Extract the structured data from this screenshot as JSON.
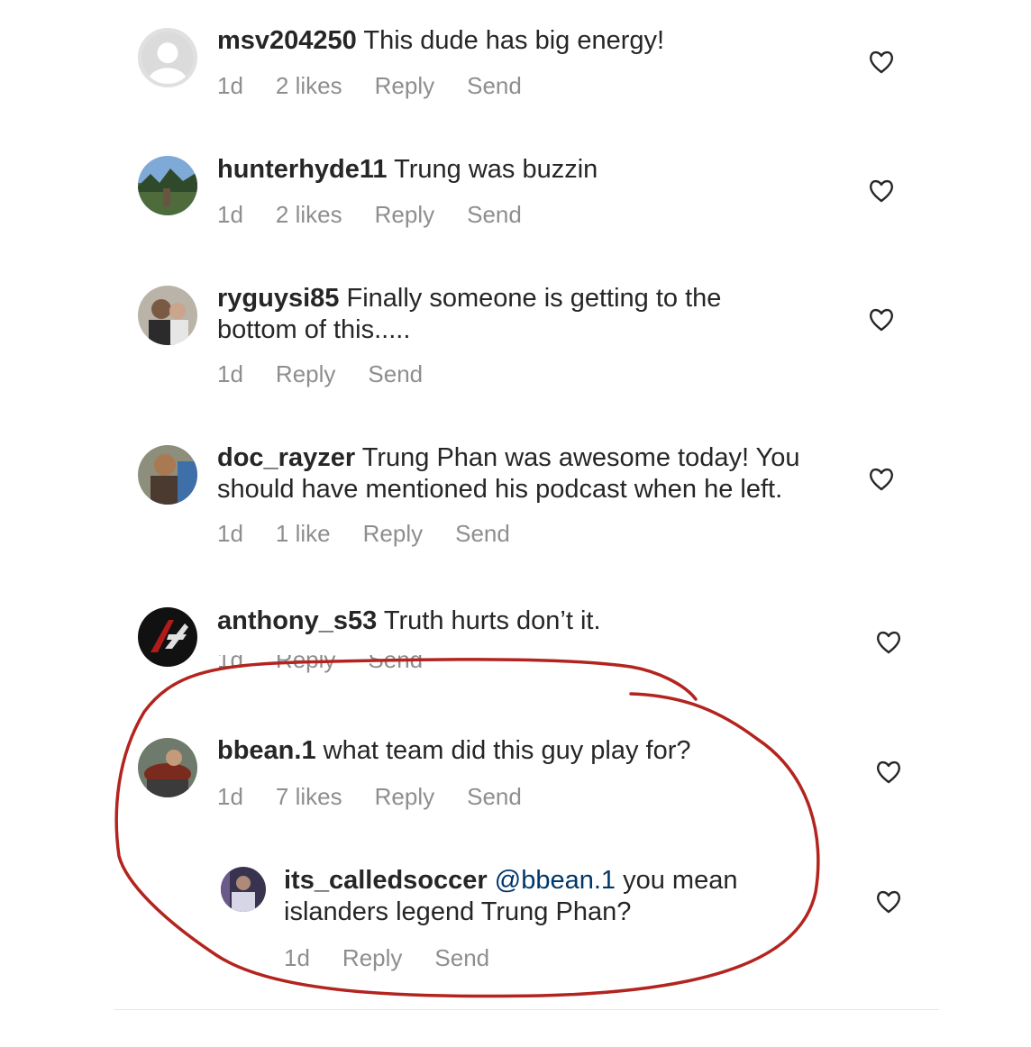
{
  "comments": [
    {
      "username": "msv204250",
      "text": "This dude has big energy!",
      "time": "1d",
      "likes": "2 likes",
      "reply": "Reply",
      "send": "Send"
    },
    {
      "username": "hunterhyde11",
      "text": "Trung was buzzin",
      "time": "1d",
      "likes": "2 likes",
      "reply": "Reply",
      "send": "Send"
    },
    {
      "username": "ryguysi85",
      "text_line1": "Finally someone is getting to the",
      "text_line2": "bottom of this.....",
      "time": "1d",
      "reply": "Reply",
      "send": "Send"
    },
    {
      "username": "doc_rayzer",
      "text_line1": "Trung Phan was awesome today! You",
      "text_line2": "should have mentioned his podcast when he left.",
      "time": "1d",
      "likes": "1 like",
      "reply": "Reply",
      "send": "Send"
    },
    {
      "username": "anthony_s53",
      "text": "Truth hurts don’t it.",
      "time": "1d",
      "reply": "Reply",
      "send": "Send"
    },
    {
      "username": "bbean.1",
      "text": "what team did this guy play for?",
      "time": "1d",
      "likes": "7 likes",
      "reply": "Reply",
      "send": "Send"
    },
    {
      "username": "its_calledsoccer",
      "mention": "@bbean.1",
      "text_line1": "you mean",
      "text_line2": "islanders legend Trung Phan?",
      "time": "1d",
      "reply": "Reply",
      "send": "Send"
    }
  ],
  "icons": {
    "like": "heart-outline-icon",
    "avatar_placeholder": "default-avatar-icon"
  },
  "colors": {
    "text": "#262626",
    "meta": "#8e8e8e",
    "mention": "#00376b",
    "annotation": "#b3241f"
  }
}
